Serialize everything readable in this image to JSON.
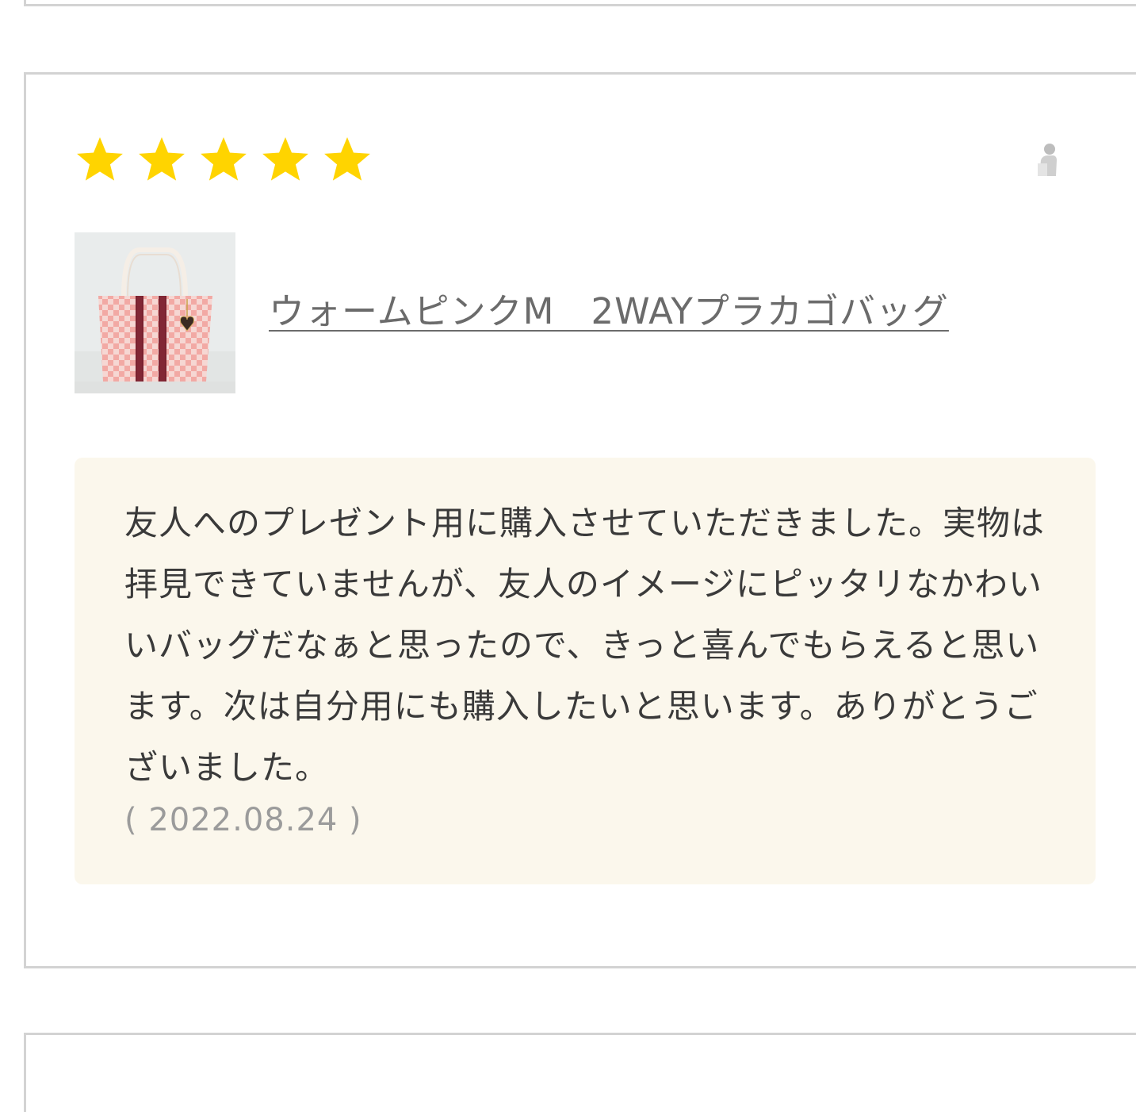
{
  "review": {
    "rating": 5,
    "rating_max": 5,
    "star_color": "#ffd400",
    "reviewer_name": "",
    "product": {
      "name": "ウォームピンクM　2WAYプラカゴバッグ",
      "thumbnail_alt": "ウォームピンクM　2WAYプラカゴバッグ"
    },
    "comment": "友人へのプレゼント用に購入させていただきました。実物は拝見できていませんが、友人のイメージにピッタリなかわいいバッグだなぁと思ったので、きっと喜んでもらえると思います。次は自分用にも購入したいと思います。ありがとうございました。",
    "date": "( 2022.08.24 )"
  },
  "colors": {
    "border": "#d3d3d3",
    "comment_bg": "#fbf7ec",
    "link_text": "#6b6b6b",
    "body_text": "#3a3a3a",
    "date_text": "#9b9b9b"
  }
}
